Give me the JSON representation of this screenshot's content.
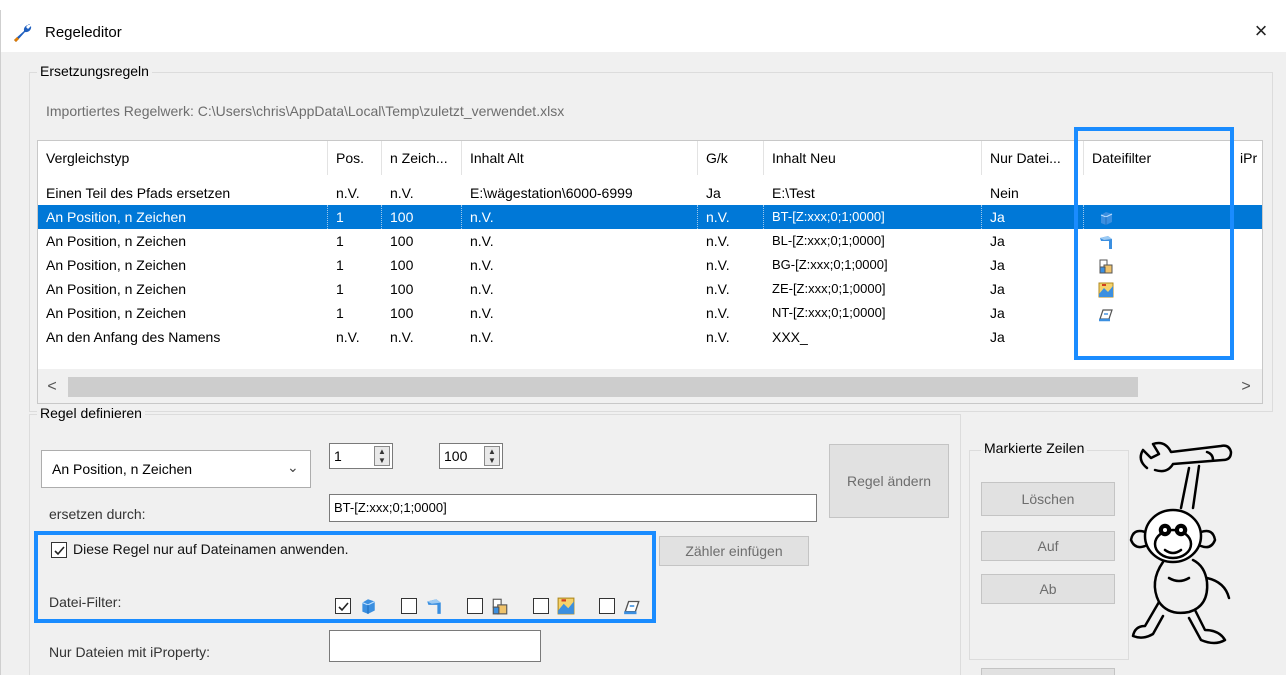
{
  "window": {
    "title": "Regeleditor",
    "close": "×"
  },
  "replacement_rules": {
    "group_label": "Ersetzungsregeln",
    "imported": "Importiertes Regelwerk: C:\\Users\\chris\\AppData\\Local\\Temp\\zuletzt_verwendet.xlsx"
  },
  "table": {
    "columns": [
      "Vergleichstyp",
      "Pos.",
      "n Zeich...",
      "Inhalt Alt",
      "G/k",
      "Inhalt Neu",
      "Nur Datei...",
      "Dateifilter",
      "iPr"
    ],
    "rows": [
      {
        "cells": [
          "Einen Teil des Pfads ersetzen",
          "n.V.",
          "n.V.",
          "E:\\wägestation\\6000-6999",
          "Ja",
          "E:\\Test",
          "Nein"
        ],
        "filter_icon": "",
        "selected": false
      },
      {
        "cells": [
          "An Position, n Zeichen",
          "1",
          "100",
          "n.V.",
          "n.V.",
          "BT-[Z:xxx;0;1;0000]",
          "Ja"
        ],
        "filter_icon": "part-icon",
        "selected": true
      },
      {
        "cells": [
          "An Position, n Zeichen",
          "1",
          "100",
          "n.V.",
          "n.V.",
          "BL-[Z:xxx;0;1;0000]",
          "Ja"
        ],
        "filter_icon": "sheet-metal-icon",
        "selected": false
      },
      {
        "cells": [
          "An Position, n Zeichen",
          "1",
          "100",
          "n.V.",
          "n.V.",
          "BG-[Z:xxx;0;1;0000]",
          "Ja"
        ],
        "filter_icon": "assembly-icon",
        "selected": false
      },
      {
        "cells": [
          "An Position, n Zeichen",
          "1",
          "100",
          "n.V.",
          "n.V.",
          "ZE-[Z:xxx;0;1;0000]",
          "Ja"
        ],
        "filter_icon": "drawing-icon",
        "selected": false
      },
      {
        "cells": [
          "An Position, n Zeichen",
          "1",
          "100",
          "n.V.",
          "n.V.",
          "NT-[Z:xxx;0;1;0000]",
          "Ja"
        ],
        "filter_icon": "presentation-icon",
        "selected": false
      },
      {
        "cells": [
          "An den Anfang des Namens",
          "n.V.",
          "n.V.",
          "n.V.",
          "n.V.",
          "XXX_",
          "Ja"
        ],
        "filter_icon": "",
        "selected": false
      }
    ],
    "scroll_left": "<",
    "scroll_right": ">"
  },
  "define_rule": {
    "group_label": "Regel definieren",
    "type_selected": "An Position, n Zeichen",
    "position": "1",
    "count": "100",
    "replace_label": "ersetzen durch:",
    "replace_value": "BT-[Z:xxx;0;1;0000]",
    "only_filenames_label": "Diese Regel nur auf Dateinamen anwenden.",
    "only_filenames_checked": true,
    "file_filter_label": "Datei-Filter:",
    "file_filters": [
      {
        "icon": "part-icon",
        "checked": true
      },
      {
        "icon": "sheet-metal-icon",
        "checked": false
      },
      {
        "icon": "assembly-icon",
        "checked": false
      },
      {
        "icon": "drawing-icon",
        "checked": false
      },
      {
        "icon": "presentation-icon",
        "checked": false
      }
    ],
    "iproperty_label": "Nur Dateien mit iProperty:",
    "iproperty_value": "",
    "change_rule_button": "Regel ändern",
    "insert_counter_button": "Zähler einfügen"
  },
  "marked_rows": {
    "group_label": "Markierte Zeilen",
    "delete_button": "Löschen",
    "up_button": "Auf",
    "down_button": "Ab"
  },
  "colors": {
    "selection": "#0078d7",
    "highlight": "#1a8cff"
  }
}
